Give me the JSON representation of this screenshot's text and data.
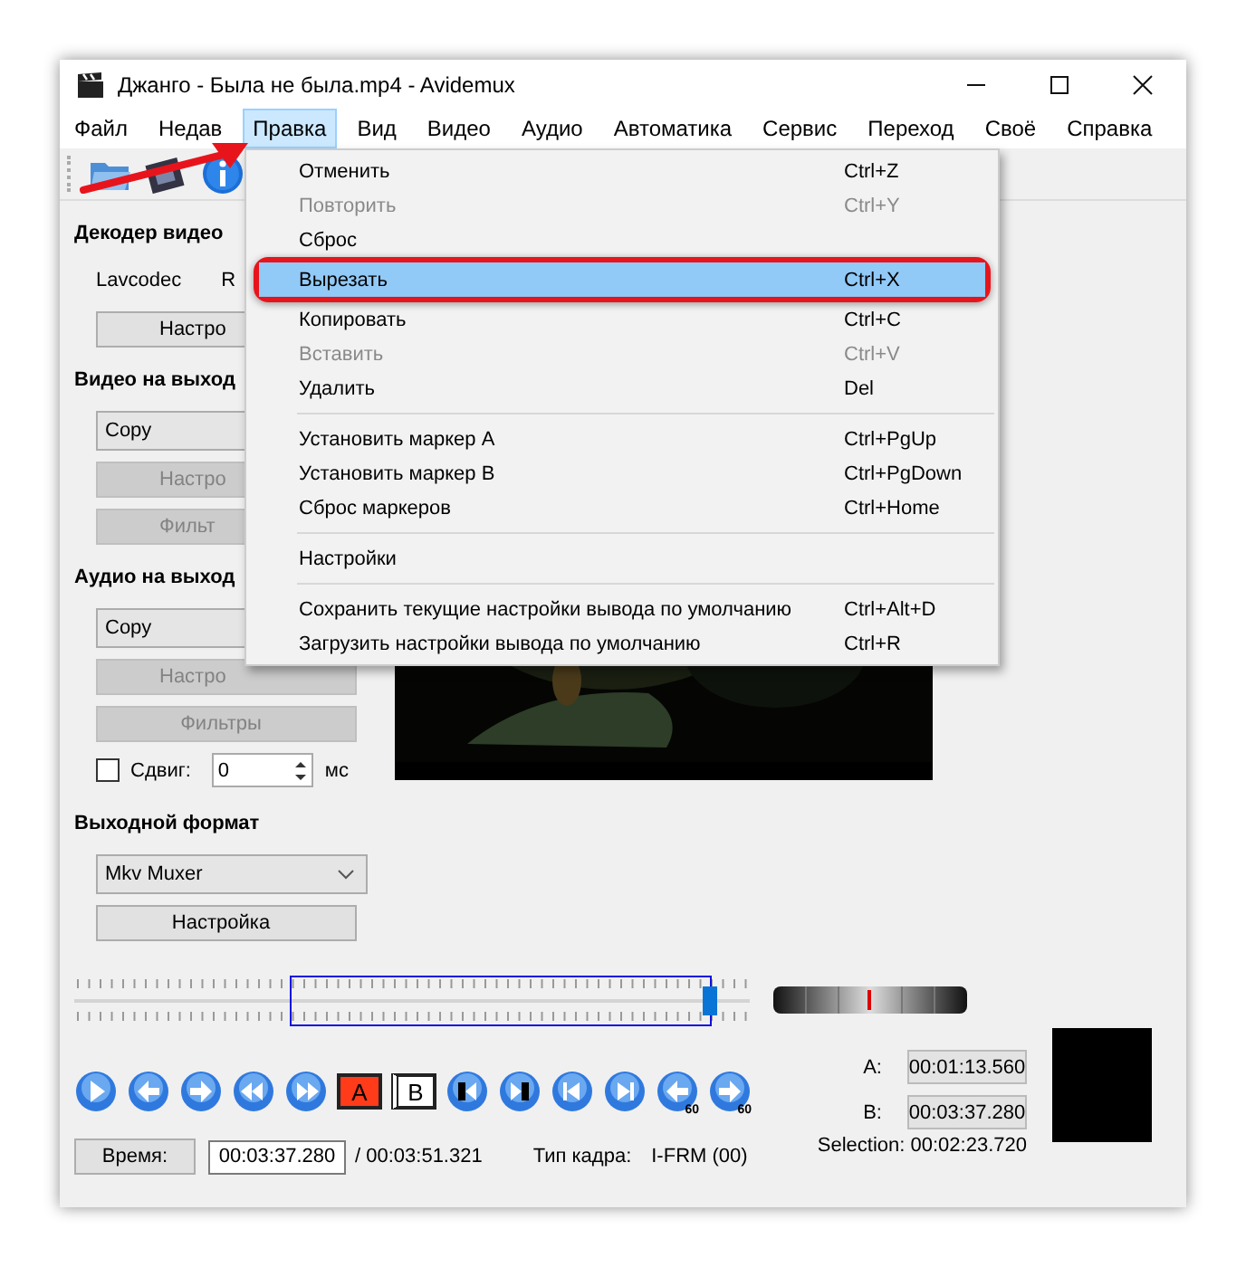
{
  "window": {
    "title": "Джанго - Была не была.mp4 - Avidemux"
  },
  "menu_bar": [
    {
      "label": "Файл",
      "selected": false
    },
    {
      "label": "Недав",
      "selected": false
    },
    {
      "label": "Правка",
      "selected": true
    },
    {
      "label": "Вид",
      "selected": false
    },
    {
      "label": "Видео",
      "selected": false
    },
    {
      "label": "Аудио",
      "selected": false
    },
    {
      "label": "Автоматика",
      "selected": false
    },
    {
      "label": "Сервис",
      "selected": false
    },
    {
      "label": "Переход",
      "selected": false
    },
    {
      "label": "Своё",
      "selected": false
    },
    {
      "label": "Справка",
      "selected": false
    }
  ],
  "annotation_arrow": true,
  "edit_menu": [
    {
      "kind": "item",
      "label": "Отменить",
      "shortcut": "Ctrl+Z",
      "disabled": false,
      "selected": false
    },
    {
      "kind": "item",
      "label": "Повторить",
      "shortcut": "Ctrl+Y",
      "disabled": true,
      "selected": false
    },
    {
      "kind": "item",
      "label": "Сброс",
      "disabled": false,
      "selected": false
    },
    {
      "kind": "item",
      "label": "Вырезать",
      "shortcut": "Ctrl+X",
      "disabled": false,
      "selected": true,
      "highlighted": true
    },
    {
      "kind": "item",
      "label": "Копировать",
      "shortcut": "Ctrl+C",
      "disabled": false,
      "selected": false
    },
    {
      "kind": "item",
      "label": "Вставить",
      "shortcut": "Ctrl+V",
      "disabled": true,
      "selected": false
    },
    {
      "kind": "item",
      "label": "Удалить",
      "shortcut": "Del",
      "disabled": false,
      "selected": false
    },
    {
      "kind": "separator"
    },
    {
      "kind": "item",
      "label": "Установить маркер A",
      "shortcut": "Ctrl+PgUp",
      "disabled": false,
      "selected": false
    },
    {
      "kind": "item",
      "label": "Установить маркер B",
      "shortcut": "Ctrl+PgDown",
      "disabled": false,
      "selected": false
    },
    {
      "kind": "item",
      "label": "Сброс маркеров",
      "shortcut": "Ctrl+Home",
      "disabled": false,
      "selected": false
    },
    {
      "kind": "separator"
    },
    {
      "kind": "item",
      "label": "Настройки",
      "disabled": false,
      "selected": false
    },
    {
      "kind": "separator"
    },
    {
      "kind": "item",
      "label": "Сохранить текущие настройки вывода по умолчанию",
      "shortcut": "Ctrl+Alt+D",
      "disabled": false,
      "selected": false
    },
    {
      "kind": "item",
      "label": "Загрузить настройки вывода по умолчанию",
      "shortcut": "Ctrl+R",
      "disabled": false,
      "selected": false
    }
  ],
  "left_panel": {
    "video_decoder": {
      "title": "Декодер видео",
      "codec": "Lavcodec",
      "column_2": "R",
      "button": "Настро"
    },
    "video_output": {
      "title": "Видео на выход",
      "codec": "Copy",
      "buttons": [
        {
          "label": "Настро",
          "disabled": true
        },
        {
          "label": "Фильт",
          "disabled": true
        }
      ]
    },
    "audio_output": {
      "title": "Аудио на выход",
      "codec": "Copy",
      "buttons": [
        {
          "label": "Настро",
          "disabled": true
        },
        {
          "label": "Фильтры",
          "disabled": true
        }
      ]
    },
    "shift": {
      "label": "Сдвиг:",
      "checked": false,
      "value": "0",
      "unit": "мс"
    },
    "output_format": {
      "title": "Выходной формат",
      "muxer": "Mkv Muxer",
      "button": "Настройка"
    }
  },
  "timeline": {
    "level": 0.94
  },
  "playback_buttons": [
    {
      "kind": "play"
    },
    {
      "kind": "prev"
    },
    {
      "kind": "next"
    },
    {
      "kind": "rewind"
    },
    {
      "kind": "forward"
    },
    {
      "kind": "marker_a",
      "label": "A"
    },
    {
      "kind": "marker_b",
      "label": "B"
    },
    {
      "kind": "goto_a"
    },
    {
      "kind": "goto_b"
    },
    {
      "kind": "first"
    },
    {
      "kind": "last"
    },
    {
      "kind": "back_60",
      "label": "60"
    },
    {
      "kind": "forward_60",
      "label": "60"
    }
  ],
  "markers": {
    "a_label": "A:",
    "a_time": "00:01:13.560",
    "b_label": "B:",
    "b_time": "00:03:37.280",
    "selection": "Selection: 00:02:23.720"
  },
  "status": {
    "time_button": "Время:",
    "time_value": "00:03:37.280",
    "duration": "/ 00:03:51.321",
    "frame_type_label": "Тип кадра:",
    "frame_type": "I-FRM (00)"
  }
}
